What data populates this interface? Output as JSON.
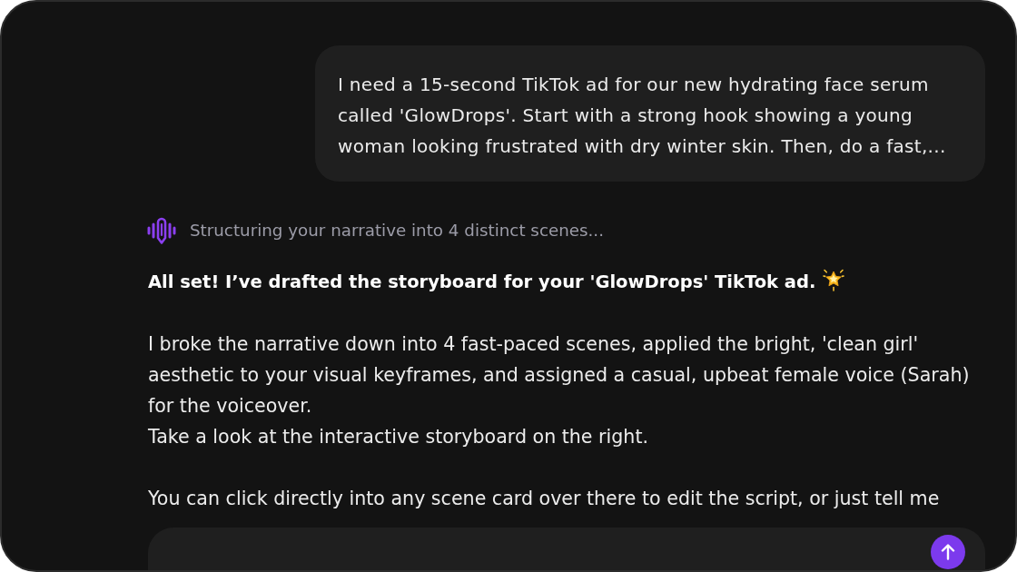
{
  "user_message": {
    "text": "I need a 15-second TikTok ad for our new hydrating face serum called 'GlowDrops'. Start with a strong hook showing a young woman looking frustrated with dry winter skin. Then, do a fast,..."
  },
  "status": {
    "text": "Structuring your narrative into 4 distinct scenes..."
  },
  "assistant_message": {
    "heading": "All set! I’ve drafted the storyboard for your 'GlowDrops' TikTok ad.",
    "paragraph_groups": [
      [
        "I broke the narrative down into 4 fast-paced scenes, applied the bright, 'clean girl' aesthetic to your visual keyframes, and assigned a casual, upbeat female voice (Sarah) for the voiceover.",
        "Take a look at the interactive storyboard on the right."
      ],
      [
        "You can click directly into any scene card over there to edit the script, or just tell me"
      ]
    ]
  }
}
